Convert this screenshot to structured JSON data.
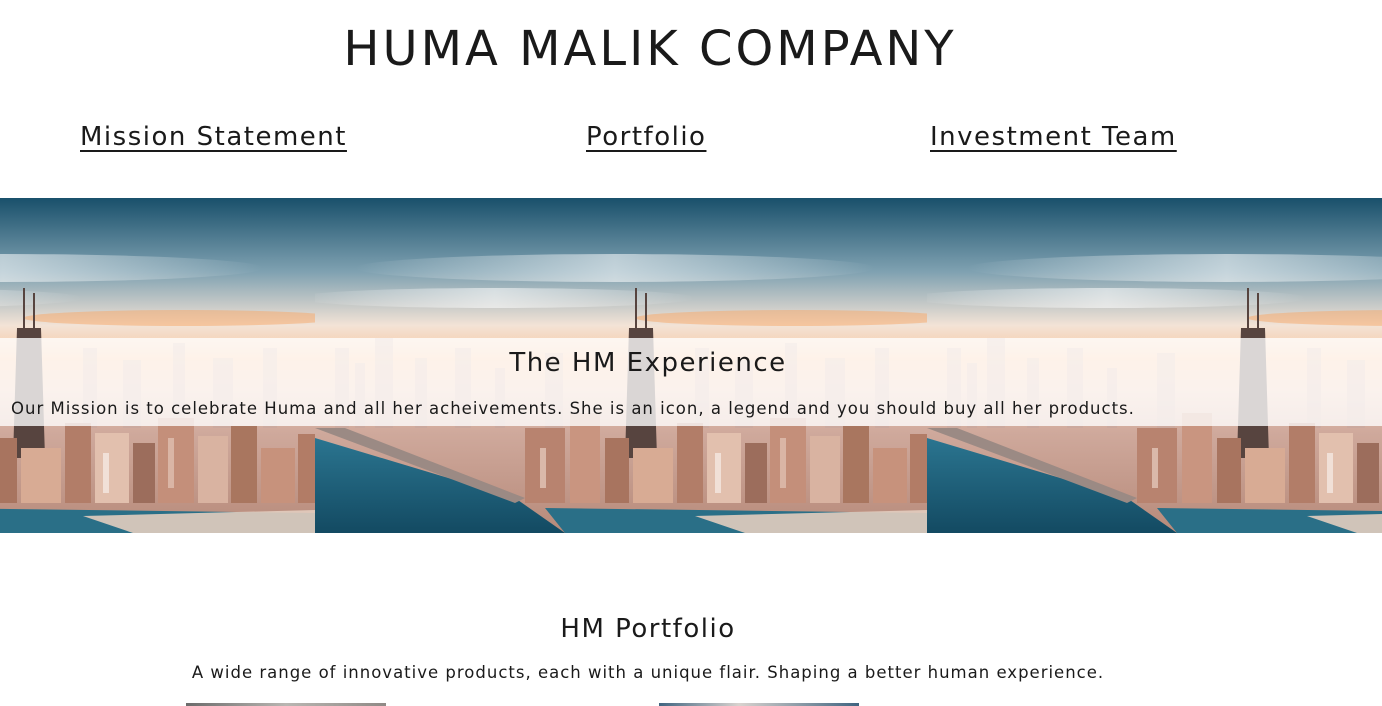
{
  "header": {
    "title": "HUMA MALIK COMPANY"
  },
  "nav": {
    "items": [
      {
        "label": "Mission Statement"
      },
      {
        "label": "Portfolio"
      },
      {
        "label": "Investment Team"
      }
    ]
  },
  "hero": {
    "heading": "The HM Experience",
    "text": "Our Mission is to celebrate Huma and all her acheivements. She is an icon, a legend and you should buy all her products."
  },
  "portfolio": {
    "heading": "HM Portfolio",
    "text": "A wide range of innovative products, each with a unique flair. Shaping a better human experience."
  },
  "colors": {
    "text": "#1a1a1a",
    "background": "#ffffff",
    "sky_top": "#1f5670",
    "sky_glow": "#f7b27a",
    "water": "#1f6179"
  }
}
